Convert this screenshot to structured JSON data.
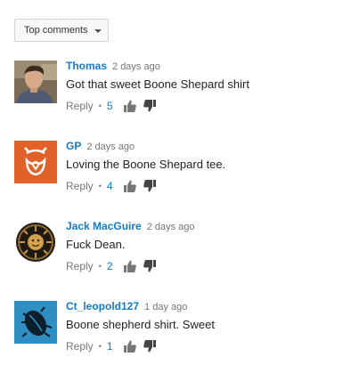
{
  "sort": {
    "label": "Top comments"
  },
  "comments": [
    {
      "author": "Thomas",
      "time": "2 days ago",
      "text": "Got that sweet Boone Shepard shirt",
      "reply_label": "Reply",
      "likes": "5"
    },
    {
      "author": "GP",
      "time": "2 days ago",
      "text": "Loving the Boone Shepard tee.",
      "reply_label": "Reply",
      "likes": "4",
      "avatar_color": "#e0622a"
    },
    {
      "author": "Jack MacGuire",
      "time": "2 days ago",
      "text": "Fuck Dean.",
      "reply_label": "Reply",
      "likes": "2"
    },
    {
      "author": "Ct_leopold127",
      "time": "1 day ago",
      "text": "Boone shepherd shirt. Sweet",
      "reply_label": "Reply",
      "likes": "1",
      "avatar_color": "#2f8fc2"
    }
  ],
  "colors": {
    "link": "#167ac6",
    "muted": "#767676",
    "text": "#222222"
  },
  "icons": {
    "like": "thumbs-up-icon",
    "dislike": "thumbs-down-icon",
    "sort_caret": "caret-down-icon"
  }
}
